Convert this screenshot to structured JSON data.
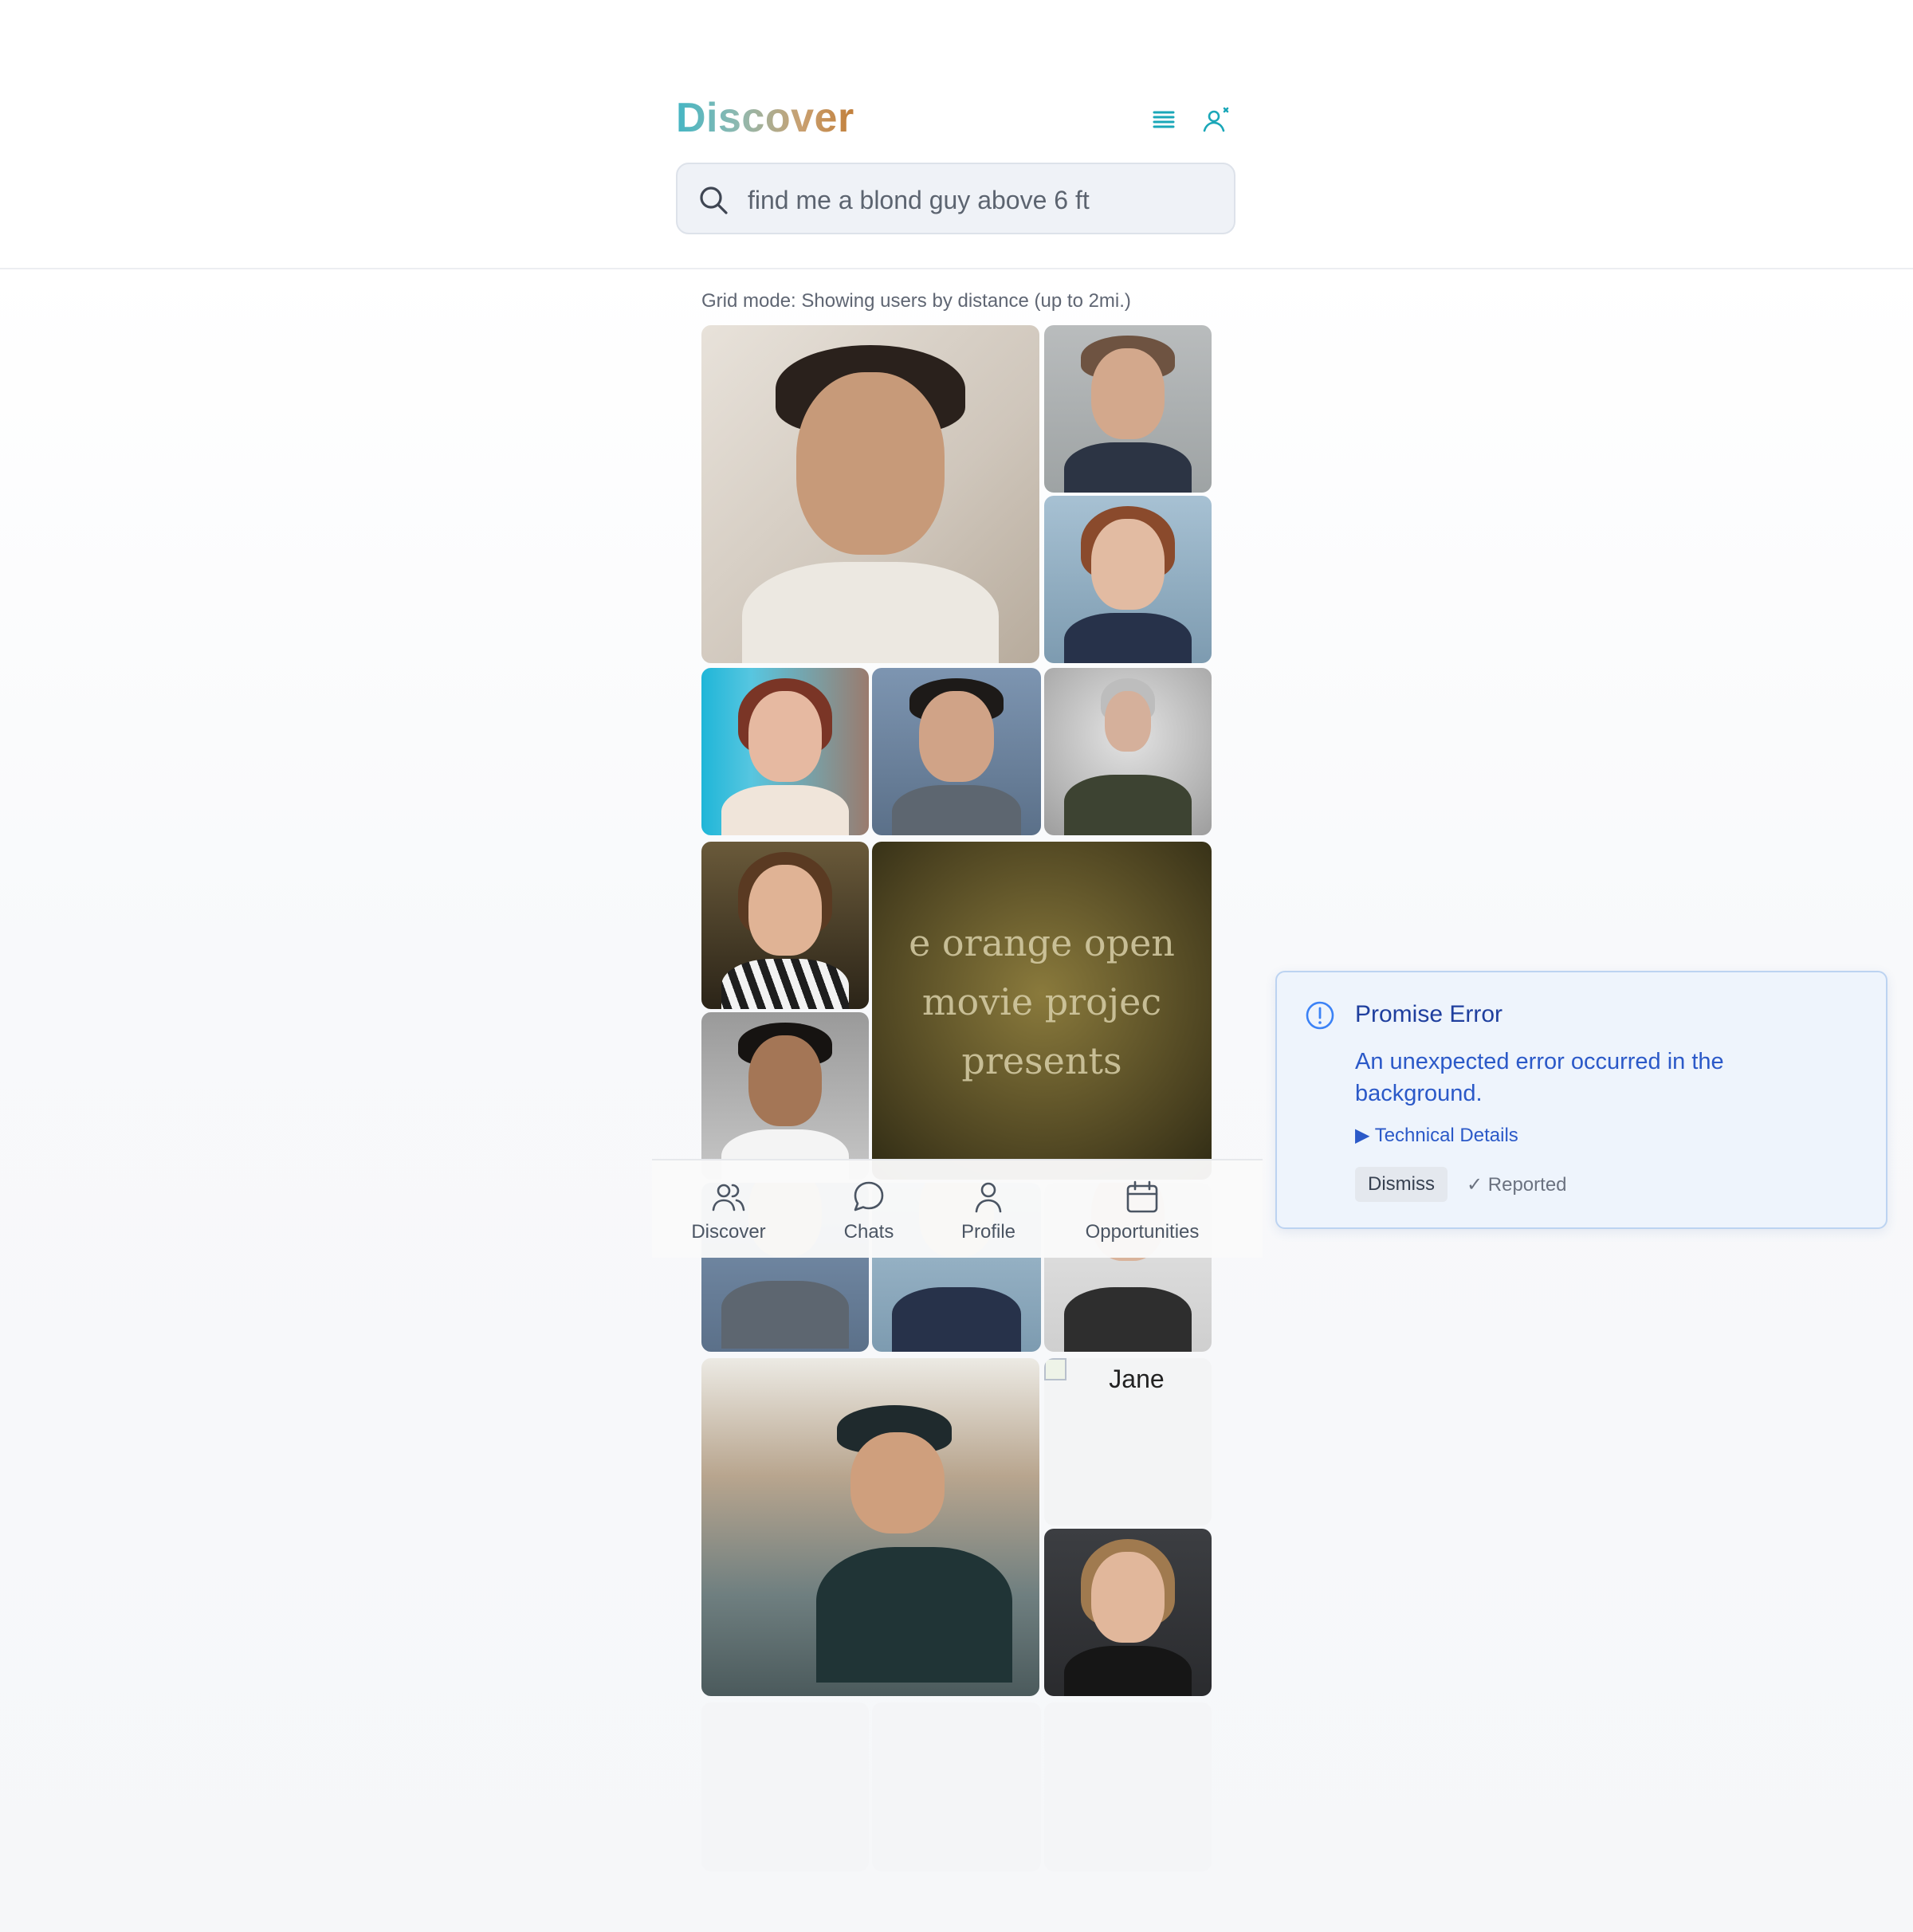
{
  "header": {
    "title": "Discover",
    "list_icon": "list-icon",
    "user_settings_icon": "user-settings-icon",
    "search": {
      "placeholder": "find me a blond guy above 6 ft",
      "icon": "search-icon"
    }
  },
  "grid": {
    "status": "Grid mode: Showing users by distance (up to 2mi.)",
    "poster_text": [
      "e orange open movie projec",
      "presents"
    ],
    "broken_image_alt": "Jane"
  },
  "nav": {
    "items": [
      {
        "label": "Discover",
        "icon": "users-icon"
      },
      {
        "label": "Chats",
        "icon": "chat-bubble-icon"
      },
      {
        "label": "Profile",
        "icon": "user-icon"
      },
      {
        "label": "Opportunities",
        "icon": "calendar-icon"
      }
    ]
  },
  "toast": {
    "title": "Promise Error",
    "message": "An unexpected error occurred in the background.",
    "details_label": "Technical Details",
    "dismiss_label": "Dismiss",
    "reported_label": "Reported",
    "icon": "alert-circle-icon",
    "accent": "#2b59c8"
  }
}
